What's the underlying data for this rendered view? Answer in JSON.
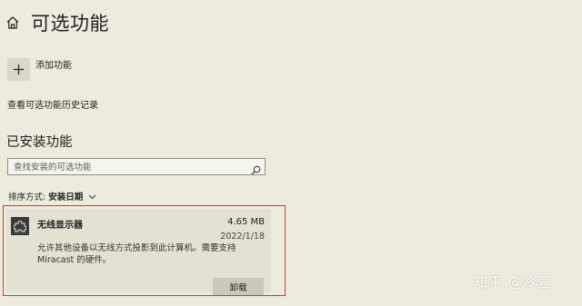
{
  "header": {
    "title": "可选功能",
    "home_icon": "home-icon"
  },
  "add_feature": {
    "label": "添加功能",
    "icon": "plus-icon"
  },
  "history_link": "查看可选功能历史记录",
  "installed": {
    "section_title": "已安装功能",
    "search": {
      "placeholder": "查找安装的可选功能",
      "value": "",
      "icon": "search-icon"
    },
    "sort": {
      "label": "排序方式:",
      "value": "安装日期",
      "icon": "chevron-down-icon"
    },
    "features": [
      {
        "name": "无线显示器",
        "size": "4.65 MB",
        "date": "2022/1/18",
        "description": "允许其他设备以无线方式投影到此计算机。需要支持 Miracast 的硬件。",
        "icon": "puzzle-icon",
        "uninstall_label": "卸载"
      }
    ]
  },
  "watermark": "知乎 @冷萱",
  "colors": {
    "background": "#ecebdd",
    "card": "#e2e1d3",
    "highlight_border": "#d23a2e"
  }
}
